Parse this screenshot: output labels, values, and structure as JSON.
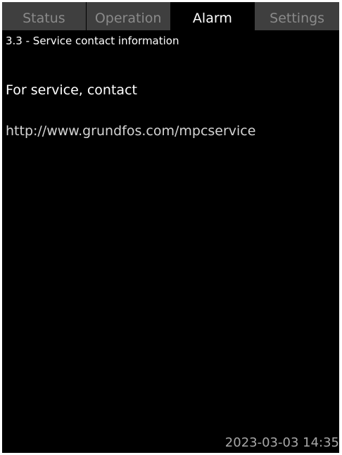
{
  "tabs": [
    {
      "label": "Status"
    },
    {
      "label": "Operation"
    },
    {
      "label": "Alarm"
    },
    {
      "label": "Settings"
    }
  ],
  "menu": {
    "title": "3.3 - Service contact information"
  },
  "content": {
    "line1": "For service, contact",
    "line2": "http://www.grundfos.com/mpcservice"
  },
  "footer": {
    "datetime": "2023-03-03 14:35"
  },
  "colors": {
    "screen_bg": "#000000",
    "tab_inactive_bg": "#3f3f3f",
    "tab_inactive_text": "#8a8a8a",
    "active_text": "#ffffff"
  }
}
